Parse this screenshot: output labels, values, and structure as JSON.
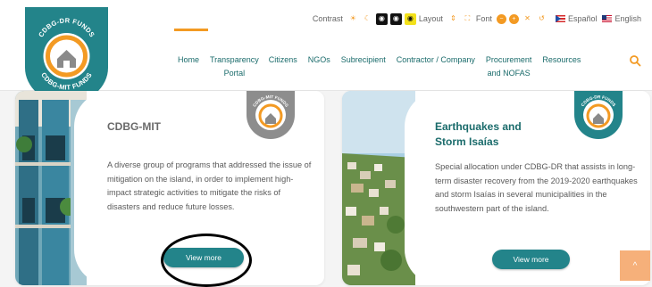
{
  "colors": {
    "teal": "#23848a",
    "orange": "#f39a23",
    "nav_text": "#1a6b6b"
  },
  "logo": {
    "top_text": "CDBG-DR FUNDS",
    "bottom_text": "CDBG-MIT FUNDS"
  },
  "accessibility": {
    "contrast_label": "Contrast",
    "layout_label": "Layout",
    "font_label": "Font",
    "icons": [
      "sun-icon",
      "moon-icon",
      "eye-black-icon",
      "eye-black-icon",
      "eye-yellow-icon",
      "layout-icon",
      "layout-expand-icon",
      "font-decrease-icon",
      "font-increase-icon",
      "font-reset-icon",
      "undo-icon"
    ]
  },
  "languages": [
    {
      "label": "Español",
      "flag": "flag-es-icon"
    },
    {
      "label": "English",
      "flag": "flag-us-icon"
    }
  ],
  "nav": [
    {
      "label": "Home"
    },
    {
      "label": "Transparency\nPortal"
    },
    {
      "label": "Citizens"
    },
    {
      "label": "NGOs"
    },
    {
      "label": "Subrecipient"
    },
    {
      "label": "Contractor / Company"
    },
    {
      "label": "Procurement\nand NOFAS"
    },
    {
      "label": "Resources"
    }
  ],
  "cards": [
    {
      "title": "CDBG-MIT",
      "badge_text": "CDBG-MIT FUNDS",
      "description": "A diverse group of programs that addressed the issue of mitigation on the island, in order to implement high-impact strategic activities to mitigate the risks of disasters and reduce future losses.",
      "button": "View more"
    },
    {
      "title": "Earthquakes and Storm Isaías",
      "badge_text": "CDBG-DR FUNDS",
      "description": "Special allocation under CDBG-DR that assists in long-term disaster recovery from the 2019-2020 earthquakes and storm Isaías in several municipalities in the southwestern part of the island.",
      "button": "View more"
    }
  ],
  "back_to_top": "^"
}
